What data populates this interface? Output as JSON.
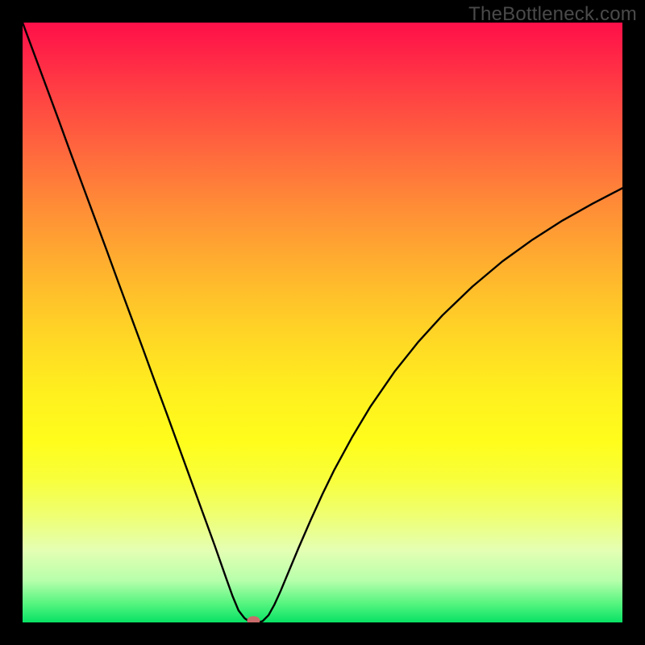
{
  "watermark": "TheBottleneck.com",
  "chart_data": {
    "type": "line",
    "title": "",
    "xlabel": "",
    "ylabel": "",
    "xlim": [
      0,
      100
    ],
    "ylim": [
      0,
      100
    ],
    "grid": false,
    "legend": false,
    "series": [
      {
        "name": "bottleneck-curve",
        "x": [
          0,
          2,
          4,
          6,
          8,
          10,
          12,
          14,
          16,
          18,
          20,
          22,
          24,
          26,
          28,
          30,
          32,
          34,
          35,
          36,
          37,
          38,
          39,
          40,
          41,
          42,
          43,
          44,
          46,
          48,
          50,
          52,
          55,
          58,
          62,
          66,
          70,
          75,
          80,
          85,
          90,
          95,
          100
        ],
        "y": [
          100,
          94.6,
          89.2,
          83.8,
          78.3,
          72.9,
          67.5,
          62.1,
          56.6,
          51.2,
          45.8,
          40.3,
          34.9,
          29.4,
          23.9,
          18.4,
          12.9,
          7.2,
          4.4,
          2.0,
          0.7,
          0.0,
          0.0,
          0.2,
          1.2,
          3.0,
          5.2,
          7.6,
          12.4,
          17.0,
          21.4,
          25.5,
          31.0,
          36.0,
          41.8,
          46.8,
          51.2,
          56.0,
          60.2,
          63.8,
          67.0,
          69.8,
          72.4
        ]
      }
    ],
    "markers": [
      {
        "name": "optimum-point",
        "x": 38.5,
        "y": 0.3,
        "color": "#c96b6b"
      }
    ],
    "background_gradient": {
      "direction": "vertical",
      "stops": [
        {
          "pos": 0.0,
          "color": "#ff0f49"
        },
        {
          "pos": 0.3,
          "color": "#ff8a37"
        },
        {
          "pos": 0.55,
          "color": "#ffdb24"
        },
        {
          "pos": 0.8,
          "color": "#efff70"
        },
        {
          "pos": 1.0,
          "color": "#08e265"
        }
      ]
    }
  }
}
